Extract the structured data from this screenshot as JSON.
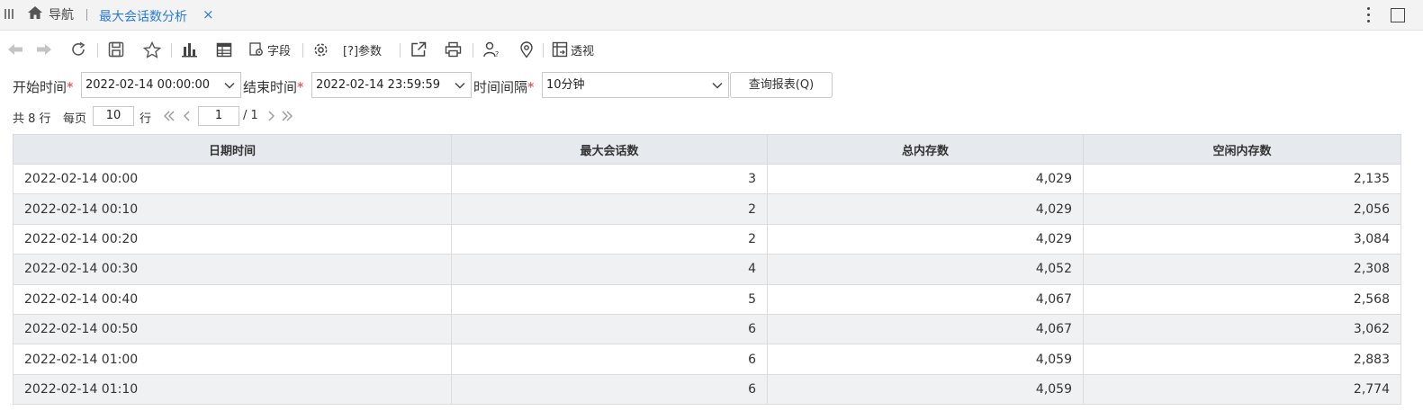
{
  "tabbar": {
    "home_label": "导航",
    "active_tab": "最大会话数分析",
    "close_glyph": "×"
  },
  "toolbar": {
    "fields_label": "字段",
    "params_label": "[?]参数",
    "pivot_label": "透视"
  },
  "filters": {
    "start_label": "开始时间",
    "start_value": "2022-02-14 00:00:00",
    "end_label": "结束时间",
    "end_value": "2022-02-14 23:59:59",
    "interval_label": "时间间隔",
    "interval_value": "10分钟",
    "required_mark": "*",
    "query_button": "查询报表(Q)"
  },
  "pager": {
    "total_text": "共 8 行",
    "per_page_label": "每页",
    "per_page_value": "10",
    "rows_unit": "行",
    "current_page": "1",
    "total_pages": "/ 1"
  },
  "table": {
    "headers": [
      "日期时间",
      "最大会话数",
      "总内存数",
      "空闲内存数"
    ],
    "rows": [
      [
        "2022-02-14  00:00",
        "3",
        "4,029",
        "2,135"
      ],
      [
        "2022-02-14  00:10",
        "2",
        "4,029",
        "2,056"
      ],
      [
        "2022-02-14  00:20",
        "2",
        "4,029",
        "3,084"
      ],
      [
        "2022-02-14  00:30",
        "4",
        "4,052",
        "2,308"
      ],
      [
        "2022-02-14  00:40",
        "5",
        "4,067",
        "2,568"
      ],
      [
        "2022-02-14  00:50",
        "6",
        "4,067",
        "3,062"
      ],
      [
        "2022-02-14  01:00",
        "6",
        "4,059",
        "2,883"
      ],
      [
        "2022-02-14  01:10",
        "6",
        "4,059",
        "2,774"
      ]
    ]
  },
  "colors": {
    "accent": "#2a7bd6",
    "required": "#e03c3c",
    "header_bg": "#e6e9ed",
    "alt_row_bg": "#f0f1f3"
  }
}
